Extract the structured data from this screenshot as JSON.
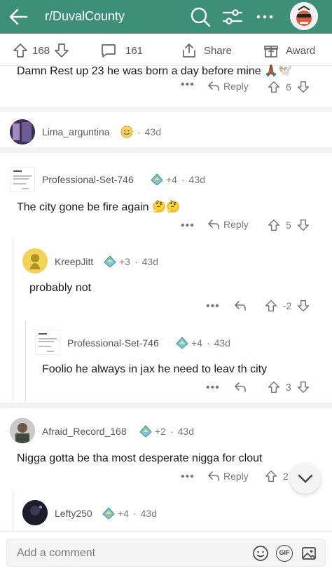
{
  "header": {
    "subreddit": "r/DuvalCounty"
  },
  "post_actions": {
    "upvotes": "168",
    "comments": "161",
    "share_label": "Share",
    "award_label": "Award"
  },
  "comments": [
    {
      "text": "Damn Rest up 23 he was born a day before mine",
      "emoji": "🙏🏾🕊️",
      "reply_label": "Reply",
      "score": "6"
    },
    {
      "username": "Lima_arguntina",
      "age": "43d"
    },
    {
      "username": "Professional-Set-746",
      "award_count": "+4",
      "age": "43d",
      "text": "The city gone be fire again",
      "emoji": "🤔🤔",
      "reply_label": "Reply",
      "score": "5"
    },
    {
      "username": "KreepJitt",
      "award_count": "+3",
      "age": "43d",
      "text": "probably not",
      "score": "-2"
    },
    {
      "username": "Professional-Set-746",
      "award_count": "+4",
      "age": "43d",
      "text": "Foolio he always in jax he need to leav th city",
      "score": "3"
    },
    {
      "username": "Afraid_Record_168",
      "award_count": "+2",
      "age": "43d",
      "text": "Nigga gotta be tha most desperate nigga for clout",
      "reply_label": "Reply",
      "score": "2"
    },
    {
      "username": "Lefty250",
      "award_count": "+4",
      "age": "43d"
    }
  ],
  "composer": {
    "placeholder": "Add a comment",
    "gif_label": "GIF"
  },
  "colors": {
    "brand": "#3d8f78",
    "award": "#7fc4d8"
  }
}
